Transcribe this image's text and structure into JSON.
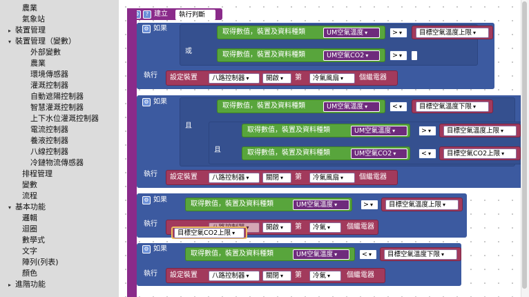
{
  "sidebar": {
    "items": [
      {
        "label": "農業",
        "indent": 1,
        "arrow": ""
      },
      {
        "label": "氣象站",
        "indent": 1,
        "arrow": ""
      },
      {
        "label": "裝置管理",
        "indent": 0,
        "arrow": "▸"
      },
      {
        "label": "裝置管理（變數）",
        "indent": 0,
        "arrow": "▾"
      },
      {
        "label": "外部變數",
        "indent": 2,
        "arrow": ""
      },
      {
        "label": "農業",
        "indent": 2,
        "arrow": ""
      },
      {
        "label": "環境傳感器",
        "indent": 2,
        "arrow": ""
      },
      {
        "label": "灌溉控制器",
        "indent": 2,
        "arrow": ""
      },
      {
        "label": "自動遮陽控制器",
        "indent": 2,
        "arrow": ""
      },
      {
        "label": "智慧灌溉控制器",
        "indent": 2,
        "arrow": ""
      },
      {
        "label": "上下水位灌溉控制器",
        "indent": 2,
        "arrow": ""
      },
      {
        "label": "電流控制器",
        "indent": 2,
        "arrow": ""
      },
      {
        "label": "養液控制器",
        "indent": 2,
        "arrow": ""
      },
      {
        "label": "八線控制器",
        "indent": 2,
        "arrow": ""
      },
      {
        "label": "冷鏈物流傳感器",
        "indent": 2,
        "arrow": ""
      },
      {
        "label": "排程管理",
        "indent": 1,
        "arrow": ""
      },
      {
        "label": "變數",
        "indent": 1,
        "arrow": ""
      },
      {
        "label": "流程",
        "indent": 1,
        "arrow": ""
      },
      {
        "label": "基本功能",
        "indent": 0,
        "arrow": "▾"
      },
      {
        "label": "邏輯",
        "indent": 1,
        "arrow": ""
      },
      {
        "label": "迴圈",
        "indent": 1,
        "arrow": ""
      },
      {
        "label": "數學式",
        "indent": 1,
        "arrow": ""
      },
      {
        "label": "文字",
        "indent": 1,
        "arrow": ""
      },
      {
        "label": "陣列(列表)",
        "indent": 1,
        "arrow": ""
      },
      {
        "label": "顏色",
        "indent": 1,
        "arrow": ""
      },
      {
        "label": "進階功能",
        "indent": 0,
        "arrow": "▸"
      }
    ]
  },
  "blocks": {
    "create_label": "建立",
    "func_name": "執行判斷",
    "if_label": "如果",
    "do_label": "執行",
    "or_label": "或",
    "and_label": "且",
    "get_label": "取得數值，裝置及資料種類",
    "set_label": "設定裝置",
    "nth_label": "第",
    "device_label": "個繼電器",
    "sensor_temp": "UM空氣溫度",
    "sensor_co2": "UM空氣CO2",
    "op_gt": ">",
    "op_lt": "<",
    "var_temp_upper": "目標空氣溫度上限",
    "var_temp_lower": "目標空氣溫度下限",
    "var_co2_upper": "目標空氣CO2上限",
    "controller": "八路控制器",
    "state_on": "開啟",
    "state_off": "關閉",
    "target_fan": "冷氣風扇",
    "target_ac": "冷氣"
  },
  "colors": {
    "sidebar_bg": "#dcdcdc",
    "function_block": "#8a2b8a",
    "if_block": "#3c5aa0",
    "value_block": "#58a53c",
    "device_block": "#a23a5c"
  }
}
